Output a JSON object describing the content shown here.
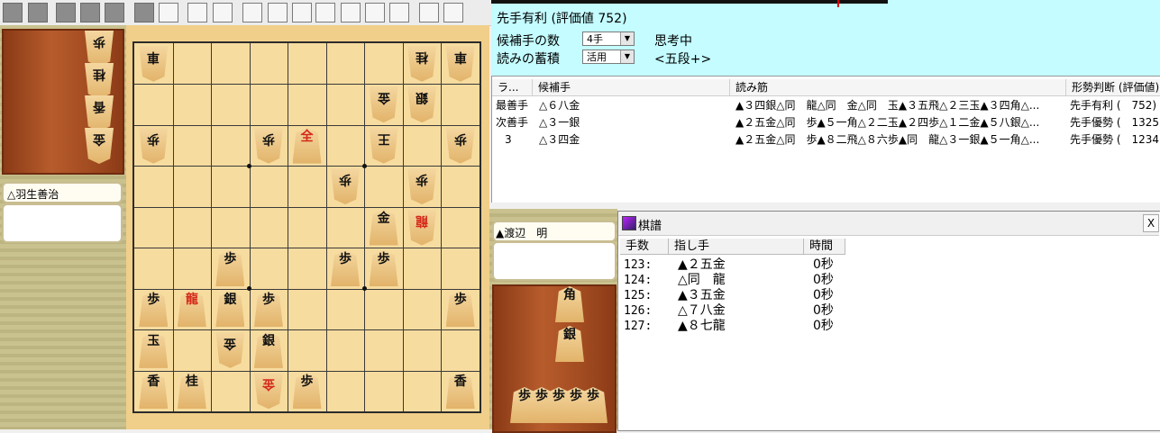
{
  "toolbar": {
    "icons": [
      "board-icon",
      "copy-icon",
      "square-icon",
      "square-icon",
      "square-icon",
      "square-icon",
      "calc-icon",
      "square-icon",
      "tree-icon",
      "tree-icon",
      "first-icon",
      "back-icon",
      "start-icon",
      "stop-icon",
      "end-icon",
      "forward-icon",
      "next-icon",
      "monitor-icon",
      "help-icon"
    ]
  },
  "players": {
    "gote": "△羽生善治",
    "sente": "▲渡辺　明"
  },
  "hands": {
    "gote": [
      "歩",
      "桂",
      "香",
      "金"
    ],
    "sente": [
      "角",
      "銀",
      "歩",
      "歩",
      "歩",
      "歩",
      "歩"
    ]
  },
  "board_pieces": [
    {
      "sq": "91",
      "k": "車",
      "side": "gote"
    },
    {
      "sq": "21",
      "k": "桂",
      "side": "gote"
    },
    {
      "sq": "11",
      "k": "車",
      "side": "gote"
    },
    {
      "sq": "32",
      "k": "金",
      "side": "gote"
    },
    {
      "sq": "22",
      "k": "銀",
      "side": "gote"
    },
    {
      "sq": "93",
      "k": "歩",
      "side": "gote"
    },
    {
      "sq": "63",
      "k": "歩",
      "side": "gote"
    },
    {
      "sq": "53",
      "k": "全",
      "side": "sente",
      "red": true
    },
    {
      "sq": "33",
      "k": "王",
      "side": "gote"
    },
    {
      "sq": "13",
      "k": "歩",
      "side": "gote"
    },
    {
      "sq": "44",
      "k": "歩",
      "side": "gote"
    },
    {
      "sq": "24",
      "k": "歩",
      "side": "gote"
    },
    {
      "sq": "35",
      "k": "金",
      "side": "sente"
    },
    {
      "sq": "25",
      "k": "龍",
      "side": "gote",
      "red": true
    },
    {
      "sq": "76",
      "k": "歩",
      "side": "sente"
    },
    {
      "sq": "46",
      "k": "歩",
      "side": "sente"
    },
    {
      "sq": "36",
      "k": "歩",
      "side": "sente"
    },
    {
      "sq": "97",
      "k": "歩",
      "side": "sente"
    },
    {
      "sq": "87",
      "k": "龍",
      "side": "sente",
      "red": true
    },
    {
      "sq": "77",
      "k": "銀",
      "side": "sente"
    },
    {
      "sq": "67",
      "k": "歩",
      "side": "sente"
    },
    {
      "sq": "17",
      "k": "歩",
      "side": "sente"
    },
    {
      "sq": "98",
      "k": "玉",
      "side": "sente"
    },
    {
      "sq": "78",
      "k": "金",
      "side": "gote"
    },
    {
      "sq": "68",
      "k": "銀",
      "side": "sente"
    },
    {
      "sq": "99",
      "k": "香",
      "side": "sente"
    },
    {
      "sq": "89",
      "k": "桂",
      "side": "sente"
    },
    {
      "sq": "69",
      "k": "金",
      "side": "gote",
      "red": true
    },
    {
      "sq": "59",
      "k": "歩",
      "side": "sente"
    },
    {
      "sq": "19",
      "k": "香",
      "side": "sente"
    }
  ],
  "info": {
    "eval_text": "先手有利 (評価値 752)",
    "candidates_label": "候補手の数",
    "candidates_value": "4手",
    "thinking": "思考中",
    "reading_label": "読みの蓄積",
    "reading_value": "活用",
    "level": "<五段+>"
  },
  "candidates": {
    "headers": [
      "ラ...",
      "候補手",
      "読み筋",
      "形勢判断 (評価値)"
    ],
    "rows": [
      {
        "rank": "最善手",
        "move": "△６八金",
        "line": "▲３四銀△同　龍△同　金△同　玉▲３五飛△２三玉▲３四角△...",
        "judge": "先手有利 (　752)"
      },
      {
        "rank": "次善手",
        "move": "△３一銀",
        "line": "▲２五金△同　歩▲５一角△２二玉▲２四歩△１二金▲５八銀△...",
        "judge": "先手優勢 (　1325)"
      },
      {
        "rank": "3",
        "move": "△３四金",
        "line": "▲２五金△同　歩▲８二飛△８六歩▲同　龍△３一銀▲５一角△...",
        "judge": "先手優勢 (　1234)"
      }
    ]
  },
  "kifu": {
    "title": "棋譜",
    "headers": [
      "手数",
      "指し手",
      "時間"
    ],
    "rows": [
      {
        "n": "123:",
        "move": "▲２五金",
        "time": "0秒"
      },
      {
        "n": "124:",
        "move": "△同　龍",
        "time": "0秒"
      },
      {
        "n": "125:",
        "move": "▲３五金",
        "time": "0秒"
      },
      {
        "n": "126:",
        "move": "△７八金",
        "time": "0秒"
      },
      {
        "n": "127:",
        "move": "▲８七龍",
        "time": "0秒"
      }
    ]
  }
}
